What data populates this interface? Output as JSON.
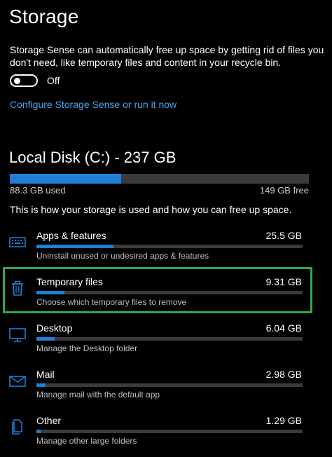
{
  "header": {
    "title": "Storage"
  },
  "storage_sense": {
    "description": "Storage Sense can automatically free up space by getting rid of files you don't need, like temporary files and content in your recycle bin.",
    "toggle_state": "Off",
    "link": "Configure Storage Sense or run it now"
  },
  "disk": {
    "title": "Local Disk (C:) - 237 GB",
    "used": "88.3 GB used",
    "free": "149 GB free",
    "used_fraction": 0.373,
    "intro": "This is how your storage is used and how you can free up space."
  },
  "categories": [
    {
      "name": "Apps & features",
      "size": "25.5 GB",
      "subtitle": "Uninstall unused or undesired apps & features",
      "icon": "keyboard-icon",
      "fill": 0.29
    },
    {
      "name": "Temporary files",
      "size": "9.31 GB",
      "subtitle": "Choose which temporary files to remove",
      "icon": "trash-icon",
      "fill": 0.105
    },
    {
      "name": "Desktop",
      "size": "6.04 GB",
      "subtitle": "Manage the Desktop folder",
      "icon": "monitor-icon",
      "fill": 0.068
    },
    {
      "name": "Mail",
      "size": "2.98 GB",
      "subtitle": "Manage mail with the default app",
      "icon": "mail-icon",
      "fill": 0.034
    },
    {
      "name": "Other",
      "size": "1.29 GB",
      "subtitle": "Manage other large folders",
      "icon": "file-icon",
      "fill": 0.015
    }
  ],
  "colors": {
    "accent": "#1f7ed8",
    "link": "#4ca6e8",
    "highlight": "#2fa84f",
    "track": "#3b3b3b"
  }
}
